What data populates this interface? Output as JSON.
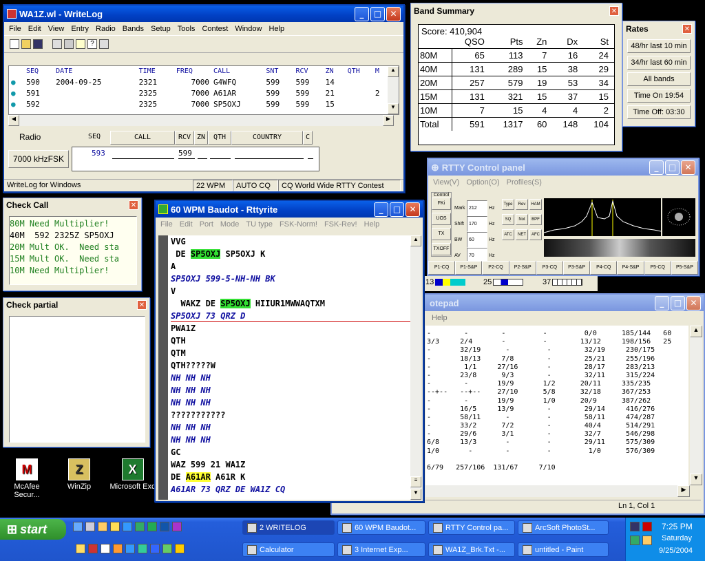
{
  "writelog": {
    "title": "WA1Z.wl - WriteLog",
    "menus": [
      "File",
      "Edit",
      "View",
      "Entry",
      "Radio",
      "Bands",
      "Setup",
      "Tools",
      "Contest",
      "Window",
      "Help"
    ],
    "columns": [
      "SEQ",
      "DATE",
      "TIME",
      "FREQ",
      "CALL",
      "SNT",
      "RCV",
      "ZN",
      "QTH",
      "M"
    ],
    "rows": [
      [
        "590",
        "2004-09-25",
        "2321",
        "7000",
        "G4WFQ",
        "599",
        "599",
        "14",
        "",
        ""
      ],
      [
        "591",
        "",
        "2325",
        "7000",
        "A61AR",
        "599",
        "599",
        "21",
        "",
        "2"
      ],
      [
        "592",
        "",
        "2325",
        "7000",
        "SP5OXJ",
        "599",
        "599",
        "15",
        "",
        ""
      ]
    ],
    "radio_label": "Radio",
    "radio_button": "7000 kHzFSK",
    "entry_headers": [
      "SEQ",
      "CALL",
      "RCV",
      "ZN",
      "QTH",
      "COUNTRY",
      "C"
    ],
    "entry_seq": "593",
    "entry_rcv": "599",
    "status": [
      "WriteLog for Windows",
      "22 WPM",
      "AUTO CQ",
      "CQ World Wide RTTY Contest"
    ]
  },
  "band_summary": {
    "title": "Band Summary",
    "score": "Score: 410,904",
    "headers": [
      "QSO",
      "Pts",
      "Zn",
      "Dx",
      "St"
    ],
    "rows": [
      [
        "80M",
        "65",
        "113",
        "7",
        "16",
        "24"
      ],
      [
        "40M",
        "131",
        "289",
        "15",
        "38",
        "29"
      ],
      [
        "20M",
        "257",
        "579",
        "19",
        "53",
        "34"
      ],
      [
        "15M",
        "131",
        "321",
        "15",
        "37",
        "15"
      ],
      [
        "10M",
        "7",
        "15",
        "4",
        "4",
        "2"
      ],
      [
        "Total",
        "591",
        "1317",
        "60",
        "148",
        "104"
      ]
    ]
  },
  "rates": {
    "title": "Rates",
    "buttons": [
      "48/hr last 10 min",
      "34/hr last 60 min",
      "All bands",
      "Time On 19:54",
      "Time Off: 03:30"
    ]
  },
  "rtty": {
    "title": "RTTY Control panel",
    "menus": [
      "View(V)",
      "Option(O)",
      "Profiles(S)"
    ],
    "group": "Control",
    "side_buttons": [
      "FKi",
      "UOS",
      "TX",
      "TXOFF"
    ],
    "mark_label": "Mark",
    "mark_value": "212",
    "shift_label": "Shift",
    "shift_value": "170",
    "bw_label": "BW",
    "bw_value": "60",
    "av_label": "AV",
    "av_value": "70",
    "hz": "Hz",
    "small_buttons": [
      "Type",
      "Rev",
      "HAM",
      "SQ",
      "Not",
      "BPF",
      "ATC",
      "NET",
      "AFC"
    ],
    "tabs": [
      "P1-CQ",
      "P1-S&P",
      "P2-CQ",
      "P2-S&P",
      "P3-CQ",
      "P3-S&P",
      "P4-CQ",
      "P4-S&P",
      "P5-CQ",
      "P5-S&P"
    ],
    "meters": [
      "13",
      "25",
      "37"
    ]
  },
  "checkcall": {
    "title": "Check Call",
    "lines": [
      "80M Need Multiplier!",
      "40M  592 2325Z SP5OXJ",
      "20M Mult OK.  Need sta",
      "15M Mult OK.  Need sta",
      "10M Need Multiplier!"
    ]
  },
  "checkpartial": {
    "title": "Check partial"
  },
  "baudot": {
    "title": "60 WPM Baudot - Rttyrite",
    "menus": [
      "File",
      "Edit",
      "Port",
      "Mode",
      "TU type",
      "FSK-Norm!",
      "FSK-Rev!",
      "Help"
    ],
    "lines": [
      {
        "t": "VVG",
        "c": "k"
      },
      {
        "t": " DE ",
        "h": "SP5OXJ",
        "r": " SP5OXJ K",
        "c": "k",
        "hc": "g"
      },
      {
        "t": "A",
        "c": "k"
      },
      {
        "t": "SP5OXJ 599-5-NH-NH BK",
        "c": "b"
      },
      {
        "t": "V",
        "c": "k"
      },
      {
        "t": "  WAKZ DE ",
        "h": "SP5OXJ",
        "r": " HIIUR1MWWAQTXM",
        "c": "k",
        "hc": "g"
      },
      {
        "t": "SP5OXJ 73 QRZ D",
        "c": "b",
        "sep": true
      },
      {
        "t": "PWA1Z",
        "c": "k"
      },
      {
        "t": "QTH",
        "c": "k"
      },
      {
        "t": "QTM",
        "c": "k"
      },
      {
        "t": "QTH?????W",
        "c": "k"
      },
      {
        "t": "NH NH NH",
        "c": "b"
      },
      {
        "t": "NH NH NH",
        "c": "b"
      },
      {
        "t": "NH NH NH",
        "c": "b"
      },
      {
        "t": "???????????",
        "c": "k"
      },
      {
        "t": "NH NH NH",
        "c": "b"
      },
      {
        "t": "NH NH NH",
        "c": "b"
      },
      {
        "t": "GC",
        "c": "k"
      },
      {
        "t": "WAZ 599 21 WA1Z",
        "c": "k"
      },
      {
        "t": "DE ",
        "h": "A61AR",
        "r": " A61R K",
        "c": "k",
        "hc": "y"
      },
      {
        "t": "A61AR 73 QRZ DE WA1Z CQ",
        "c": "b"
      }
    ]
  },
  "notepad": {
    "title": "otepad",
    "menu": "Help",
    "status": "Ln 1, Col 1",
    "lines": [
      "-        -        -         -         0/0      185/144   60",
      "3/3     2/4       -         -        13/12     198/156   25",
      "-       32/19      -         -        32/19     230/175",
      "-       18/13     7/8        -        25/21     255/196",
      "-        1/1     27/16       -        28/17     283/213",
      "-       23/8      9/3        -        32/11     315/224",
      "-        -       19/9       1/2      20/11     335/235",
      "--+--   --+--    27/10      5/8      32/18     367/253",
      "-        -       19/9       1/0      20/9      387/262",
      "-       16/5     13/9        -        29/14     416/276",
      "-       58/11      -         -        58/11     474/287",
      "-       33/2      7/2        -        40/4      514/291",
      "-       29/6      3/1        -        32/7      546/298",
      "6/8     13/3       -         -        29/11     575/309",
      "1/0       -        -         -         1/0      576/309",
      "",
      "6/79   257/106  131/67     7/10"
    ]
  },
  "desktop": {
    "icons": [
      {
        "name": "McAfee Secur...",
        "glyph": "M"
      },
      {
        "name": "WinZip",
        "glyph": "Z"
      },
      {
        "name": "Microsoft Exc",
        "glyph": "X"
      }
    ]
  },
  "taskbar": {
    "start": "start",
    "row1": [
      "2 WRITELOG",
      "60 WPM Baudot...",
      "RTTY Control pa...",
      "ArcSoft PhotoSt..."
    ],
    "row2": [
      "Calculator",
      "3 Internet Exp...",
      "WA1Z_Brk.Txt -...",
      "untitled - Paint"
    ],
    "time": "7:25 PM",
    "day": "Saturday",
    "date": "9/25/2004"
  },
  "colors": {
    "xp_blue": "#245edb",
    "taskbar": "#1f5bd6",
    "start_green": "#3a9a2c",
    "highlight_green": "#33e033",
    "highlight_yellow": "#ffff33",
    "text_blue": "#1010a0"
  }
}
